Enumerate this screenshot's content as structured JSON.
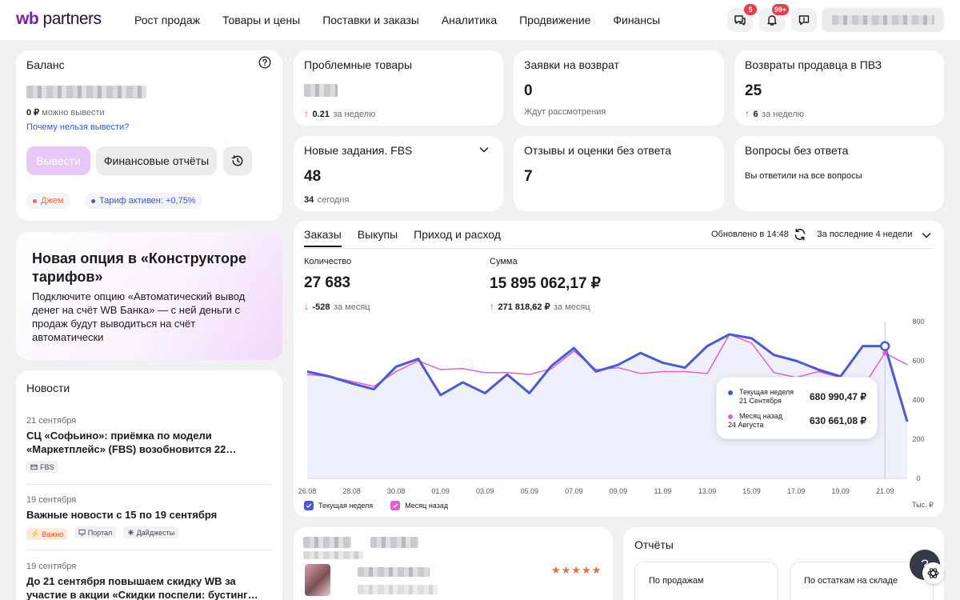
{
  "header": {
    "logo_wb": "wb",
    "logo_partners": "partners",
    "nav": [
      "Рост продаж",
      "Товары и цены",
      "Поставки и заказы",
      "Аналитика",
      "Продвижение",
      "Финансы"
    ],
    "chat_badge": "5",
    "notif_badge": "99+"
  },
  "balance": {
    "title": "Баланс",
    "withdraw_amount": "0 ₽",
    "withdraw_caption": "можно вывести",
    "why_link": "Почему нельзя вывести?",
    "withdraw_button": "Вывести",
    "reports_button": "Финансовые отчёты",
    "pill_jam": "Джем",
    "pill_tariff": "Тариф активен: +0,75%",
    "pill_jam_color": "#f26b3a",
    "pill_tariff_color": "#4a58e0"
  },
  "promo": {
    "title": "Новая опция в «Конструкторе тарифов»",
    "text": "Подключите опцию «Автоматический вывод денег на счёт WB Банка» — с ней деньги с продаж будут выводиться на счёт автоматически"
  },
  "metrics": {
    "problem_goods": {
      "title": "Проблемные товары",
      "delta": "0.21",
      "period": "за неделю"
    },
    "return_requests": {
      "title": "Заявки на возврат",
      "value": "0",
      "sub": "Ждут рассмотрения"
    },
    "seller_returns": {
      "title": "Возвраты продавца в ПВЗ",
      "value": "25",
      "delta": "6",
      "period": "за неделю"
    },
    "fbs_tasks": {
      "title": "Новые задания. FBS",
      "value": "48",
      "today_num": "34",
      "today_label": "сегодня"
    },
    "reviews": {
      "title": "Отзывы и оценки без ответа",
      "value": "7"
    },
    "questions": {
      "title": "Вопросы без ответа",
      "sub": "Вы ответили на все вопросы"
    }
  },
  "orders": {
    "tabs": [
      "Заказы",
      "Выкупы",
      "Приход и расход"
    ],
    "updated": "Обновлено в 14:48",
    "period": "За последние 4 недели",
    "qty_label": "Количество",
    "qty_value": "27 683",
    "qty_delta": "-528",
    "qty_period": "за месяц",
    "sum_label": "Сумма",
    "sum_value": "15 895 062,17 ₽",
    "sum_delta": "271 818,62 ₽",
    "sum_period": "за месяц",
    "legend_current": "Текущая неделя",
    "legend_prev": "Месяц назад",
    "unit": "Тыс. ₽",
    "tooltip": {
      "cur_label": "Текущая неделя",
      "cur_date": "21 Сентября",
      "cur_value": "680 990,47 ₽",
      "prev_label": "Месяц назад",
      "prev_date": "24 Августа",
      "prev_value": "630 661,08 ₽"
    }
  },
  "chart_data": {
    "type": "line",
    "x": [
      "26.08",
      "27.08",
      "28.08",
      "29.08",
      "30.08",
      "31.08",
      "01.09",
      "02.09",
      "03.09",
      "04.09",
      "05.09",
      "06.09",
      "07.09",
      "08.09",
      "09.09",
      "10.09",
      "11.09",
      "12.09",
      "13.09",
      "14.09",
      "15.09",
      "16.09",
      "17.09",
      "18.09",
      "19.09",
      "20.09",
      "21.09",
      "22.09"
    ],
    "x_ticks": [
      "26.08",
      "28.08",
      "30.08",
      "01.09",
      "03.09",
      "05.09",
      "07.09",
      "09.09",
      "11.09",
      "13.09",
      "15.09",
      "17.09",
      "19.09",
      "21.09"
    ],
    "y_ticks": [
      0,
      200,
      400,
      600,
      800
    ],
    "ylim": [
      0,
      800
    ],
    "unit": "Тыс. ₽",
    "series": [
      {
        "name": "Текущая неделя",
        "color": "#4b58db",
        "values": [
          545,
          520,
          485,
          455,
          570,
          610,
          425,
          490,
          435,
          530,
          435,
          575,
          665,
          545,
          580,
          640,
          590,
          565,
          675,
          735,
          715,
          630,
          600,
          555,
          520,
          675,
          675,
          290
        ]
      },
      {
        "name": "Месяц назад",
        "color": "#e45fd3",
        "values": [
          530,
          520,
          495,
          470,
          545,
          600,
          555,
          560,
          540,
          540,
          530,
          560,
          650,
          555,
          565,
          535,
          545,
          545,
          535,
          735,
          690,
          540,
          515,
          545,
          515,
          465,
          640,
          580
        ]
      }
    ],
    "highlight_x": "21.09",
    "legend": "bottom-left",
    "grid": false
  },
  "news": {
    "title": "Новости",
    "items": [
      {
        "date": "21 сентября",
        "title": "СЦ «Софьино»: приёмка по модели «Маркетплейс» (FBS) возобновится 22…",
        "tags": [
          "FBS"
        ]
      },
      {
        "date": "19 сентября",
        "title": "Важные новости с 15 по 19 сентября",
        "tags": [
          "Важно",
          "Портал",
          "Дайджесты"
        ]
      },
      {
        "date": "19 сентября",
        "title": "До 21 сентября повышаем скидку WB за участие в акции «Скидки поспели: бустинг…",
        "tags": []
      }
    ]
  },
  "reports": {
    "title": "Отчёты",
    "by_sales": "По продажам",
    "by_stock": "По остаткам на складе"
  }
}
